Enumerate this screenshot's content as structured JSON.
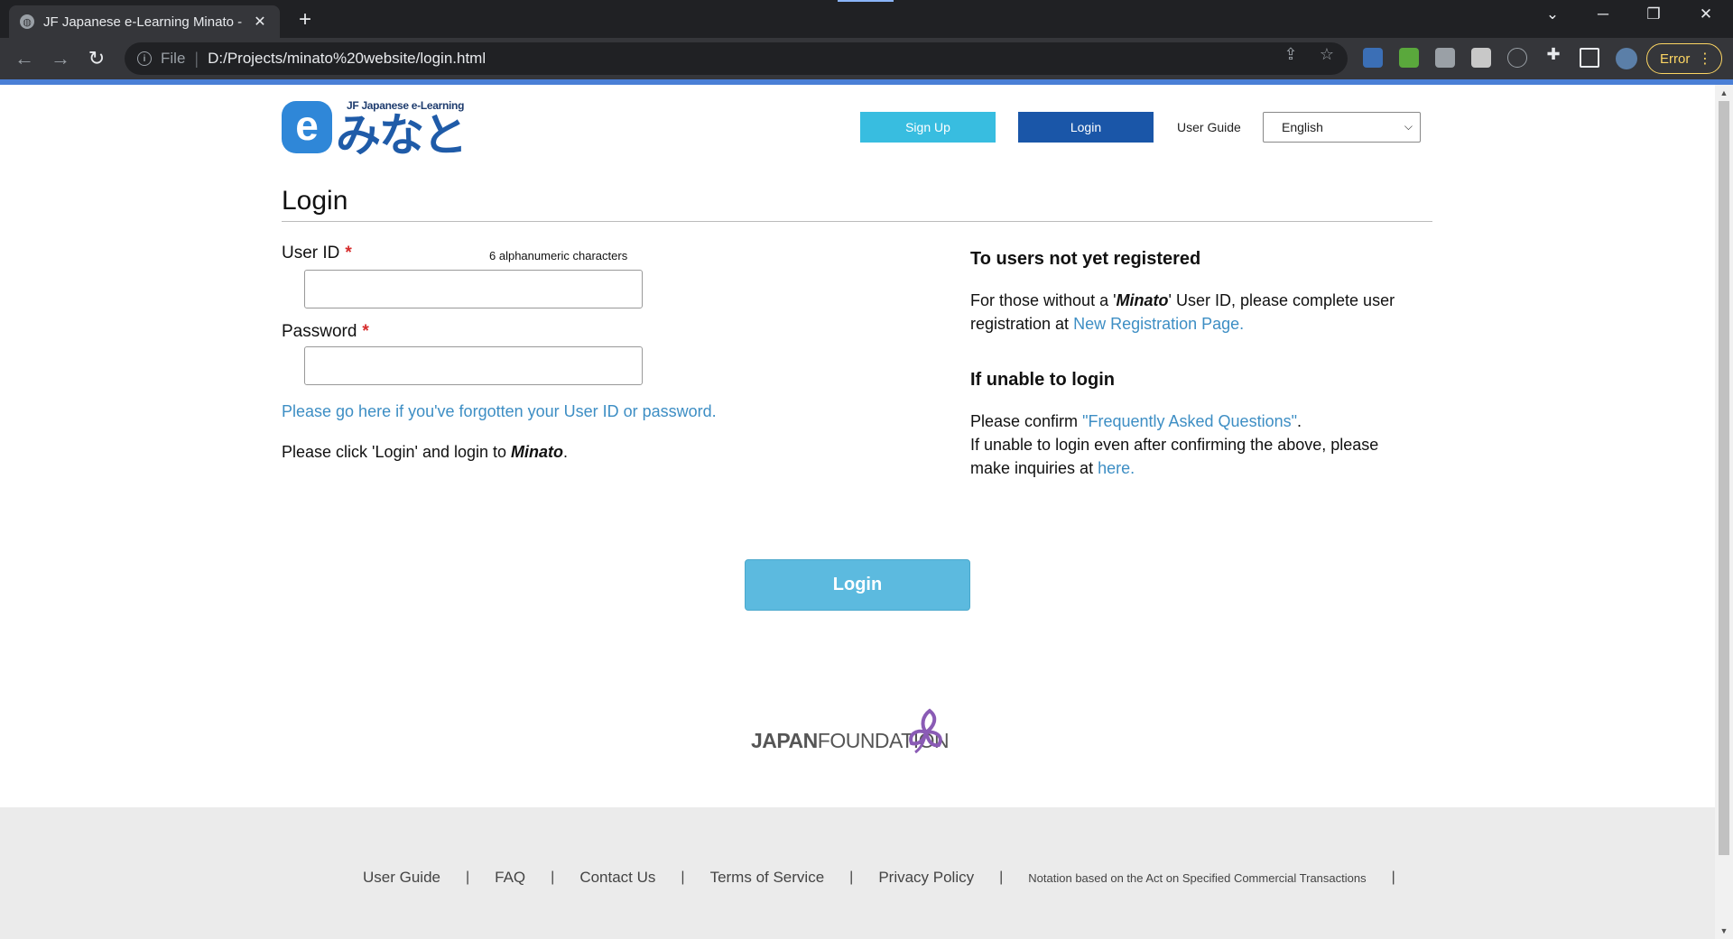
{
  "browser": {
    "tab_title": "JF Japanese e-Learning Minato -",
    "address_scheme": "File",
    "address_url": "D:/Projects/minato%20website/login.html",
    "error_label": "Error"
  },
  "header": {
    "logo_subtitle": "JF Japanese e-Learning",
    "logo_kana": "みなと",
    "logo_e": "e",
    "signup_label": "Sign Up",
    "login_label": "Login",
    "user_guide_label": "User Guide",
    "language_selected": "English"
  },
  "main": {
    "title": "Login",
    "user_id_label": "User ID",
    "user_id_hint": "6 alphanumeric characters",
    "user_id_value": "",
    "password_label": "Password",
    "password_value": "",
    "required_mark": "*",
    "forgot_link": "Please go here if you've forgotten your User ID or password.",
    "instruction_prefix": "Please click 'Login' and login to",
    "instruction_brand": "Minato",
    "instruction_suffix": "."
  },
  "side": {
    "not_registered_heading": "To users not yet registered",
    "not_registered_text_1": "For those without a '",
    "not_registered_brand": "Minato",
    "not_registered_text_2": "' User ID, please complete user registration at",
    "new_registration_link": "New Registration Page.",
    "unable_heading": "If unable to login",
    "unable_text_1": "Please confirm",
    "faq_link": "\"Frequently Asked Questions\"",
    "unable_text_2": ".",
    "unable_text_3": "If unable to login even after confirming the above, please make inquiries at",
    "here_link": "here."
  },
  "login_button_label": "Login",
  "japan_foundation": {
    "bold": "JAPAN",
    "light": "FOUNDATION"
  },
  "footer": {
    "links": [
      "User Guide",
      "FAQ",
      "Contact Us",
      "Terms of Service",
      "Privacy Policy",
      "Notation based on the Act on Specified Commercial Transactions"
    ],
    "separator": "|"
  },
  "colors": {
    "signup": "#38bde0",
    "login_top": "#1a56a8",
    "login_main": "#5cbadf",
    "link": "#3d8ec4",
    "required": "#d62c2c"
  }
}
